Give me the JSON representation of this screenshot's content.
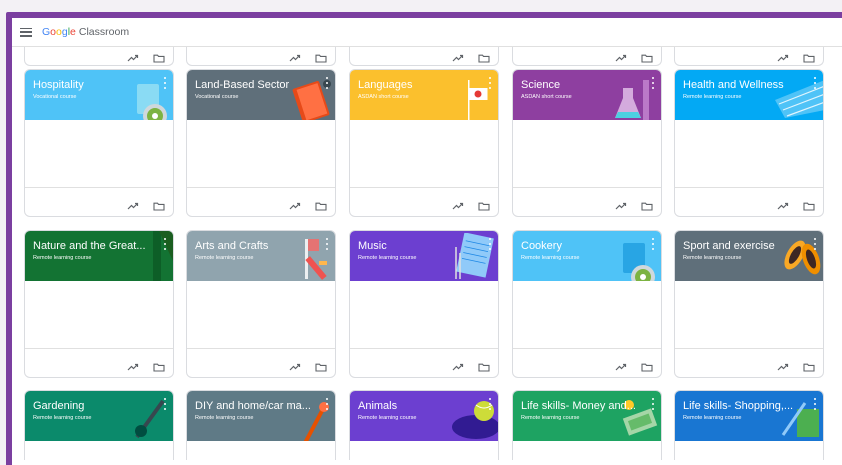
{
  "app": {
    "logo": {
      "g1": "G",
      "g2": "o",
      "g3": "o",
      "g4": "g",
      "g5": "l",
      "g6": "e"
    },
    "product": "Classroom"
  },
  "courses": [
    {
      "title": "Hospitality",
      "subtitle": "Vocational course",
      "color": "#4fc3f7",
      "icon": "poker-chip-illustration"
    },
    {
      "title": "Land-Based Sector",
      "subtitle": "Vocational course",
      "color": "#5f6f7a",
      "icon": "book-illustration"
    },
    {
      "title": "Languages",
      "subtitle": "ASDAN short course",
      "color": "#fbc02d",
      "icon": "flag-illustration"
    },
    {
      "title": "Science",
      "subtitle": "ASDAN short course",
      "color": "#8e3fa0",
      "icon": "flask-illustration"
    },
    {
      "title": "Health and Wellness",
      "subtitle": "Remote learning course",
      "color": "#03a9f4",
      "icon": "pool-illustration"
    },
    {
      "title": "Nature and the Great...",
      "subtitle": "Remote learning course",
      "color": "#137333",
      "icon": "tree-illustration"
    },
    {
      "title": "Arts and Crafts",
      "subtitle": "Remote learning course",
      "color": "#90a4ae",
      "icon": "paint-brush-illustration"
    },
    {
      "title": "Music",
      "subtitle": "Remote learning course",
      "color": "#6c3fd0",
      "icon": "sheet-music-illustration"
    },
    {
      "title": "Cookery",
      "subtitle": "Remote learning course",
      "color": "#4fc3f7",
      "icon": "plate-illustration"
    },
    {
      "title": "Sport and exercise",
      "subtitle": "Remote learning course",
      "color": "#5f6f7a",
      "icon": "shoes-illustration"
    },
    {
      "title": "Gardening",
      "subtitle": "Remote learning course",
      "color": "#0b8a6b",
      "icon": "trowel-illustration"
    },
    {
      "title": "DIY and home/car ma...",
      "subtitle": "Remote learning course",
      "color": "#5f7a86",
      "icon": "wrench-illustration"
    },
    {
      "title": "Animals",
      "subtitle": "Remote learning course",
      "color": "#6c3fd0",
      "icon": "ball-illustration"
    },
    {
      "title": "Life skills- Money and...",
      "subtitle": "Remote learning course",
      "color": "#1ea362",
      "icon": "money-illustration"
    },
    {
      "title": "Life skills- Shopping,...",
      "subtitle": "Remote learning course",
      "color": "#1976d2",
      "icon": "shopping-illustration"
    }
  ],
  "icons": {
    "menu": "hamburger-icon",
    "trend": "trending-up-icon",
    "folder": "folder-icon",
    "more": "more-vert-icon"
  }
}
